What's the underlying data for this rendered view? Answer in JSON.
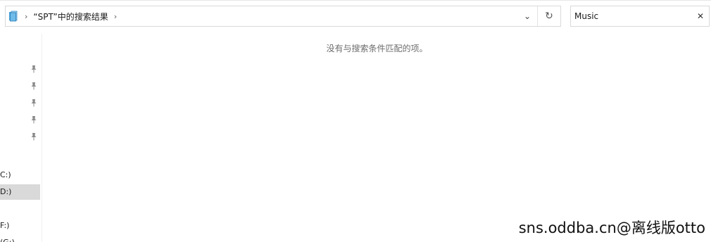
{
  "address_bar": {
    "location_icon": "library-folder-icon",
    "breadcrumb_separator": "›",
    "breadcrumb_label": "“SPT”中的搜索结果",
    "dropdown_icon": "chevron-down-icon",
    "dropdown_glyph": "⌄",
    "refresh_icon": "refresh-icon",
    "refresh_glyph": "↻"
  },
  "search": {
    "value": "Music",
    "clear_icon": "close-icon",
    "clear_glyph": "✕"
  },
  "nav_pane": {
    "pin_icon": "pin-icon",
    "pin_glyph": "📌",
    "pinned_count_visible": 5,
    "drives": [
      {
        "label": "C:)",
        "selected": false
      },
      {
        "label": "D:)",
        "selected": true
      },
      {
        "label": "F:)",
        "selected": false
      },
      {
        "label": "(G:)",
        "selected": false
      }
    ]
  },
  "content": {
    "empty_message": "没有与搜索条件匹配的项。"
  },
  "watermark": {
    "text": "sns.oddba.cn@离线版otto"
  },
  "colors": {
    "border": "#d9d9d9",
    "selected_bg": "#d9d9d9",
    "muted_text": "#6d6d6d",
    "folder_blue": "#4aa3df"
  }
}
